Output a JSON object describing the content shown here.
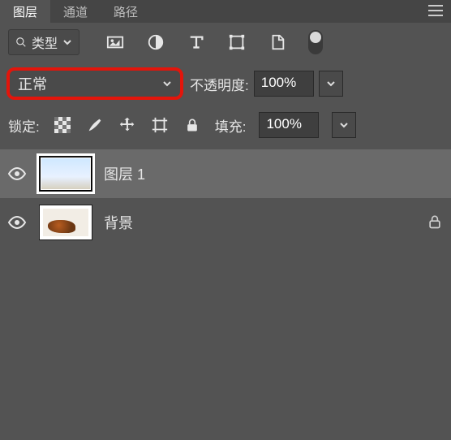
{
  "tabs": {
    "layers": "图层",
    "channels": "通道",
    "paths": "路径"
  },
  "typeFilter": {
    "label": "类型"
  },
  "blend": {
    "mode": "正常",
    "opacityLabel": "不透明度:",
    "opacityValue": "100%"
  },
  "lock": {
    "label": "锁定:",
    "fillLabel": "填充:",
    "fillValue": "100%"
  },
  "layers_list": [
    {
      "name": "图层 1",
      "selected": true,
      "locked": false
    },
    {
      "name": "背景",
      "selected": false,
      "locked": true
    }
  ]
}
